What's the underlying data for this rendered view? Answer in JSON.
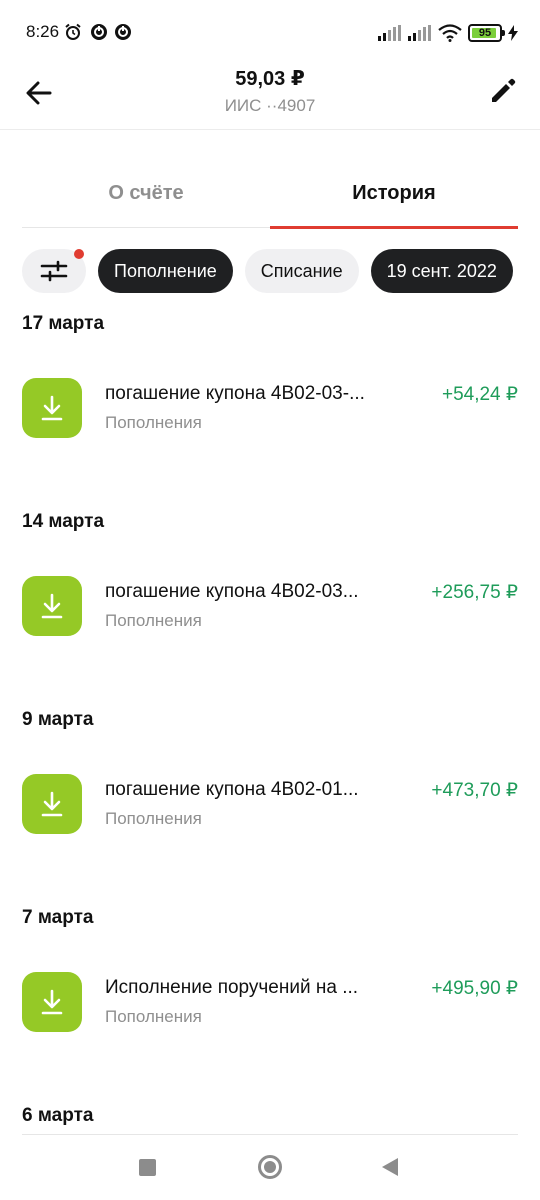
{
  "status_bar": {
    "time": "8:26",
    "battery": "95",
    "icons": [
      "alarm-icon",
      "notification-icon",
      "notification-icon",
      "signal-icon",
      "signal-icon",
      "wifi-icon",
      "battery-icon",
      "charging-icon"
    ]
  },
  "header": {
    "title": "59,03 ₽",
    "subtitle": "ИИС ··4907"
  },
  "tabs": [
    {
      "label": "О счёте",
      "active": false
    },
    {
      "label": "История",
      "active": true
    }
  ],
  "filters": {
    "chips": [
      {
        "label": "Пополнение",
        "style": "dark"
      },
      {
        "label": "Списание",
        "style": "light"
      },
      {
        "label": "19 сент. 2022",
        "style": "dark"
      }
    ]
  },
  "history": [
    {
      "date": "17 марта",
      "title": "погашение купона 4B02-03-...",
      "category": "Пополнения",
      "amount": "+54,24 ₽"
    },
    {
      "date": "14 марта",
      "title": "погашение купона 4B02-03...",
      "category": "Пополнения",
      "amount": "+256,75 ₽"
    },
    {
      "date": "9 марта",
      "title": "погашение купона 4B02-01...",
      "category": "Пополнения",
      "amount": "+473,70 ₽"
    },
    {
      "date": "7 марта",
      "title": "Исполнение поручений на ...",
      "category": "Пополнения",
      "amount": "+495,90 ₽"
    },
    {
      "date": "6 марта"
    }
  ],
  "colors": {
    "accent_red": "#e03c31",
    "icon_green": "#95c926",
    "amount_green": "#1f9c5a",
    "chip_dark": "#1f2022"
  }
}
